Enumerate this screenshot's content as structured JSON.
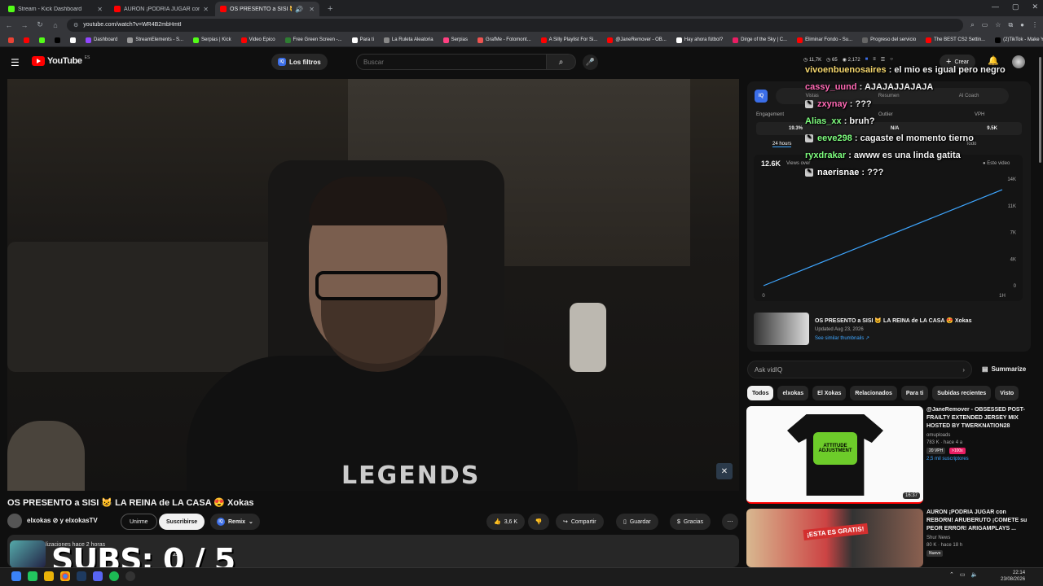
{
  "browser": {
    "tabs": [
      {
        "title": "Stream - Kick Dashboard",
        "color": "#53fc18"
      },
      {
        "title": "AURON ¡PODRIA JUGAR con R",
        "color": "#ff0000"
      },
      {
        "title": "OS PRESENTO a SISI 🐱 LA",
        "color": "#ff0000",
        "active": true
      }
    ],
    "new_tab": "+",
    "url": "youtube.com/watch?v=WR4B2mbHmtI",
    "bookmarks": [
      {
        "label": "",
        "color": "#ea4335"
      },
      {
        "label": "",
        "color": "#ff0000"
      },
      {
        "label": "",
        "color": "#53fc18"
      },
      {
        "label": "",
        "color": "#000000"
      },
      {
        "label": "",
        "color": "#ffffff"
      },
      {
        "label": "Dashboard",
        "color": "#9146ff"
      },
      {
        "label": "StreamElements - S...",
        "color": "#999999"
      },
      {
        "label": "Serpias | Kick",
        "color": "#53fc18"
      },
      {
        "label": "Video Epico",
        "color": "#ff0000"
      },
      {
        "label": "Free Green Screen -...",
        "color": "#2e7d32"
      },
      {
        "label": "Para ti",
        "color": "#ffffff"
      },
      {
        "label": "La Ruleta Aleatoria",
        "color": "#888888"
      },
      {
        "label": "Serpias",
        "color": "#ff4081"
      },
      {
        "label": "GrafMe - Fotomont...",
        "color": "#ef5350"
      },
      {
        "label": "A Silly Playlist For Si...",
        "color": "#ff0000"
      },
      {
        "label": "@JaneRemover - OB...",
        "color": "#ff0000"
      },
      {
        "label": "Hay ahora fútbol?",
        "color": "#ffffff"
      },
      {
        "label": "Dirge of the Sky | C...",
        "color": "#e91e63"
      },
      {
        "label": "Eliminar Fondo - Su...",
        "color": "#ff0000"
      },
      {
        "label": "Progreso del servicio",
        "color": "#666666"
      },
      {
        "label": "The BEST CS2 Settin...",
        "color": "#ff0000"
      },
      {
        "label": "(2)TikTok - Make Yo...",
        "color": "#000000"
      }
    ]
  },
  "yt": {
    "logo": "YouTube",
    "country": "ES",
    "filters": "Los filtros",
    "search_placeholder": "Buscar",
    "stats": [
      "11,7K",
      "65",
      "2,172"
    ],
    "create": "Crear",
    "video_title": "OS PRESENTO a SISI 😺 LA REINA de LA CASA 😍 Xokas",
    "channel": "elxokas ⊘ y elxokasTV",
    "join": "Unirme",
    "subscribe": "Suscribirse",
    "remix": "Remix",
    "likes": "3,6 K",
    "share": "Compartir",
    "save": "Guardar",
    "thanks": "Gracias",
    "desc_line1": "lizaciones  hace 2 horas",
    "desc_line2": "kas",
    "shirt_text": "LEGENDS"
  },
  "overlay": {
    "subs": "SUBS: 0 / 5"
  },
  "chat": [
    {
      "user": "vivoenbuenosaires",
      "msg": " : el mio es igual pero negro",
      "color": "#f5d76e",
      "badge": false
    },
    {
      "user": "cassy_uund",
      "msg": " : AJAJAJJAJAJA",
      "color": "#ff69b4",
      "badge": false
    },
    {
      "user": "zxynay",
      "msg": " : ???",
      "color": "#ff69b4",
      "badge": true
    },
    {
      "user": "Alias_xx",
      "msg": " : bruh?",
      "color": "#7fff7f",
      "badge": false
    },
    {
      "user": "eeve298",
      "msg": " : cagaste el momento tierno",
      "color": "#7fff7f",
      "badge": true
    },
    {
      "user": "ryxdrakar",
      "msg": " : awww es una linda gatita",
      "color": "#7fff7f",
      "badge": false
    },
    {
      "user": "naerisnae",
      "msg": " : ???",
      "color": "#ffffff",
      "badge": true
    }
  ],
  "vidiq": {
    "logo": "IQ",
    "tabs": [
      "Vistas",
      "Resumen",
      "AI Coach"
    ],
    "engagement_label": "Engagement",
    "outlier_label": "Outlier",
    "vph_label": "VPH",
    "engagement": "19.3%",
    "outlier": "N/A",
    "vph": "9.5K",
    "time_tabs": [
      "24 hours",
      "Todo"
    ],
    "views_total": "12.6K",
    "views_label": "Views over",
    "este_video": "Este video",
    "yticks": [
      "14K",
      "11K",
      "7K",
      "4K",
      "0"
    ],
    "xticks": [
      "0",
      "1H"
    ],
    "thumb_title": "OS PRESENTO a SISI 😺 LA REINA de LA CASA 😍 Xokas",
    "thumb_date": "Updated Aug 23, 2026",
    "thumb_link": "See similar thumbnails ↗",
    "ask": "Ask vidIQ",
    "summarize": "Summarize"
  },
  "chart_data": {
    "type": "line",
    "x": [
      0,
      1
    ],
    "xlabel": "",
    "ylabel": "",
    "series": [
      {
        "values": [
          0,
          12600
        ]
      }
    ],
    "ylim": [
      0,
      14000
    ],
    "xtick_labels": [
      "0",
      "1H"
    ],
    "ytick_labels": [
      "0",
      "4K",
      "7K",
      "11K",
      "14K"
    ],
    "line_color": "#3ea6ff",
    "grid": false
  },
  "chips": [
    "Todos",
    "elxokas",
    "El Xokas",
    "Relacionados",
    "Para ti",
    "Subidas recientes",
    "Visto"
  ],
  "recs": [
    {
      "title": "@JaneRemover - OBSESSED POST-FRAILTY EXTENDED JERSEY MIX HOSTED BY TWERKNATION28",
      "channel": "omuploads",
      "meta": "783 K · hace 4 a",
      "badge1": "20 VPH",
      "badge2": ">100x",
      "subs": "2,5 mil suscriptores",
      "duration": "16:37",
      "shirt_logo": "ATTITUDE ADJUSTMENT"
    },
    {
      "title": "AURON ¡PODRIA JUGAR con REBORN! ARUBERUTO ¡COMETE su PEOR ERROR! ARIGAMPLAYS ...",
      "channel": "Shur News",
      "meta": "80 K · hace 18 h",
      "badge1": "Nuevo",
      "thumb_text": "¡ESTA ES GRATIS!"
    }
  ],
  "taskbar": {
    "time": "22:14",
    "date": "23/08/2026"
  }
}
